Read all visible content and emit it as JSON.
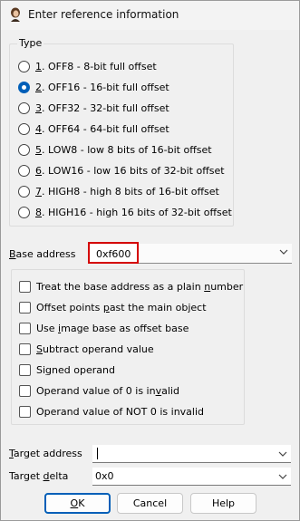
{
  "window": {
    "title": "Enter reference information"
  },
  "type_group": {
    "legend": "Type",
    "options": [
      {
        "key": "1",
        "rest": ". OFF8 - 8-bit full offset",
        "checked": false
      },
      {
        "key": "2",
        "rest": ". OFF16 - 16-bit full offset",
        "checked": true
      },
      {
        "key": "3",
        "rest": ". OFF32 - 32-bit full offset",
        "checked": false
      },
      {
        "key": "4",
        "rest": ". OFF64 - 64-bit full offset",
        "checked": false
      },
      {
        "key": "5",
        "rest": ". LOW8 - low 8 bits of 16-bit offset",
        "checked": false
      },
      {
        "key": "6",
        "rest": ". LOW16 - low 16 bits of 32-bit offset",
        "checked": false
      },
      {
        "key": "7",
        "rest": ". HIGH8 - high 8 bits of 16-bit offset",
        "checked": false
      },
      {
        "key": "8",
        "rest": ". HIGH16 - high 16 bits of 32-bit offset",
        "checked": false
      }
    ]
  },
  "base_address": {
    "label_pre": "",
    "label_key": "B",
    "label_post": "ase address",
    "value": "0xf600"
  },
  "options": [
    {
      "pre": "Treat the base address as a plain ",
      "key": "n",
      "post": "umber",
      "checked": false
    },
    {
      "pre": "Offset points ",
      "key": "p",
      "post": "ast the main object",
      "checked": false
    },
    {
      "pre": "Use ",
      "key": "i",
      "post": "mage base as offset base",
      "checked": false
    },
    {
      "pre": "",
      "key": "S",
      "post": "ubtract operand value",
      "checked": false
    },
    {
      "pre": "Si",
      "key": "g",
      "post": "ned operand",
      "checked": false
    },
    {
      "pre": "Operand value of 0 is in",
      "key": "v",
      "post": "alid",
      "checked": false
    },
    {
      "pre": "Operand value of NOT 0 is invalid",
      "key": "",
      "post": "",
      "checked": false
    }
  ],
  "target_address": {
    "label_key": "T",
    "label_post": "arget address",
    "value": ""
  },
  "target_delta": {
    "label_pre": "Target ",
    "label_key": "d",
    "label_post": "elta",
    "value": "0x0"
  },
  "buttons": {
    "ok_key": "O",
    "ok_post": "K",
    "cancel": "Cancel",
    "help": "Help"
  }
}
